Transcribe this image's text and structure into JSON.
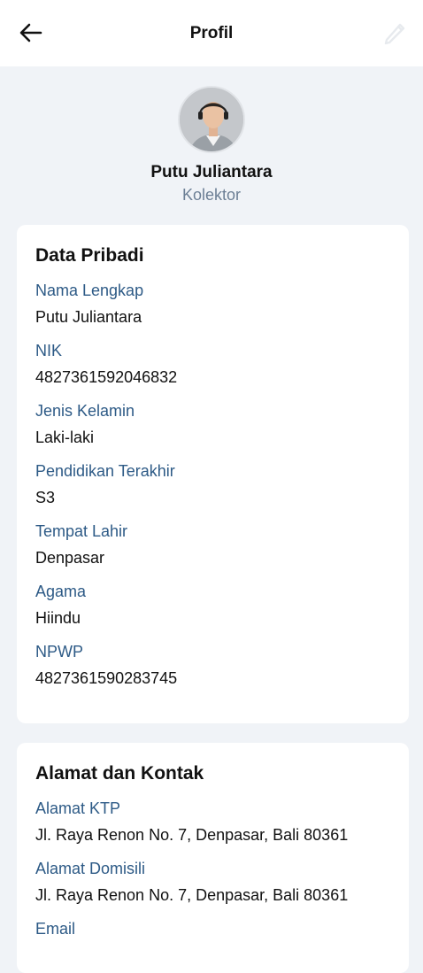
{
  "app_bar": {
    "title": "Profil",
    "back_icon": "arrow-left-icon",
    "edit_icon": "pencil-icon"
  },
  "profile": {
    "name": "Putu Juliantara",
    "role": "Kolektor"
  },
  "personal": {
    "title": "Data Pribadi",
    "fields": [
      {
        "label": "Nama Lengkap",
        "value": "Putu Juliantara"
      },
      {
        "label": "NIK",
        "value": "4827361592046832"
      },
      {
        "label": "Jenis Kelamin",
        "value": "Laki-laki"
      },
      {
        "label": "Pendidikan Terakhir",
        "value": "S3"
      },
      {
        "label": "Tempat Lahir",
        "value": "Denpasar"
      },
      {
        "label": "Agama",
        "value": "Hiindu"
      },
      {
        "label": "NPWP",
        "value": "4827361590283745"
      }
    ]
  },
  "address": {
    "title": "Alamat dan Kontak",
    "fields": [
      {
        "label": "Alamat KTP",
        "value": "Jl. Raya Renon No. 7, Denpasar, Bali 80361"
      },
      {
        "label": "Alamat Domisili",
        "value": "Jl. Raya Renon No. 7, Denpasar, Bali 80361"
      },
      {
        "label": "Email"
      }
    ]
  },
  "colors": {
    "background": "#f0f3f7",
    "label": "#2d5a86",
    "role": "#6c7f95",
    "card": "#ffffff"
  }
}
